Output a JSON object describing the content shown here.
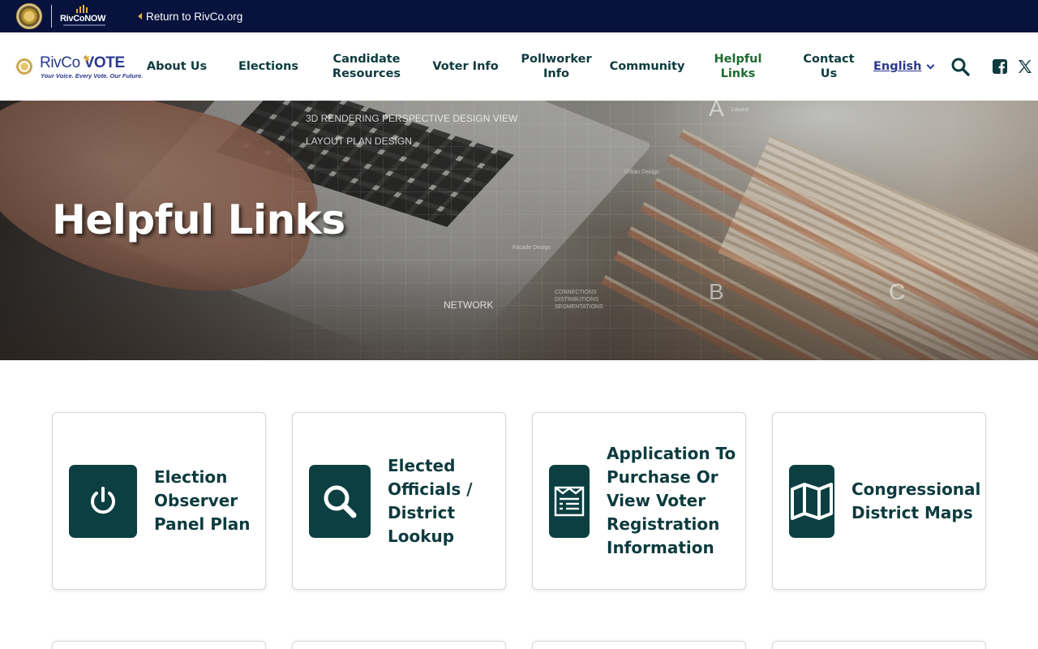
{
  "topbar": {
    "rivconow_logo_text": "RivCoNOW",
    "return_link": "Return to RivCo.org"
  },
  "nav": {
    "brand_rivco": "RivCo",
    "brand_vote": "VOTE",
    "brand_tagline": "Your Voice. Every Vote. Our Future.",
    "items": [
      {
        "label": "About Us"
      },
      {
        "label": "Elections"
      },
      {
        "label": "Candidate Resources"
      },
      {
        "label": "Voter Info"
      },
      {
        "label": "Pollworker Info"
      },
      {
        "label": "Community"
      },
      {
        "label": "Helpful Links",
        "active": true
      },
      {
        "label": "Contact Us"
      }
    ],
    "language": "English",
    "icons": [
      "search-icon",
      "facebook-icon",
      "x-icon"
    ]
  },
  "hero": {
    "title": "Helpful Links",
    "overlay_texts": {
      "design_view": "3D RENDERING PERSPECTIVE DESIGN VIEW",
      "layout_plan": "LAYOUT PLAN DESIGN",
      "network": "NETWORK",
      "connections": "CONNECTIONS",
      "distributions": "DISTRIBUTIONS",
      "segmentations": "SEGMENTATIONS",
      "urban_design": "Urban Design",
      "facade_design": "Facade Design",
      "layout": "Layout",
      "letter_a": "A",
      "letter_b": "B",
      "letter_c": "C"
    }
  },
  "cards": [
    {
      "label": "Election Observer Panel Plan",
      "icon": "power-icon"
    },
    {
      "label": "Elected Officials / District Lookup",
      "icon": "search-icon"
    },
    {
      "label": "Application To Purchase Or View Voter Registration Information",
      "icon": "receipt-icon"
    },
    {
      "label": "Congressional District Maps",
      "icon": "map-icon"
    }
  ],
  "colors": {
    "topbar_bg": "#07123d",
    "nav_text": "#0d3b3e",
    "nav_active": "#1c6b2f",
    "brand_blue": "#2a3a8c",
    "accent_gold": "#e3b13a",
    "card_icon_bg": "#0b3f41"
  }
}
